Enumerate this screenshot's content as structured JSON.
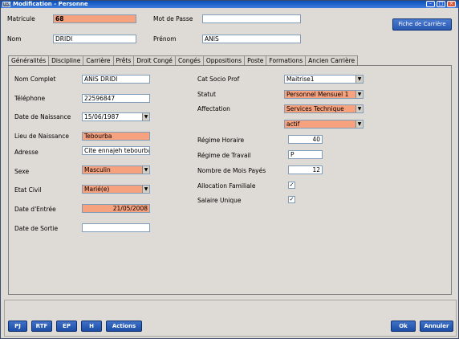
{
  "window": {
    "title": "Modification - Personne",
    "app_icon_text": "TDF"
  },
  "header": {
    "matricule_label": "Matricule",
    "matricule_value": "68",
    "mot_de_passe_label": "Mot de Passe",
    "mot_de_passe_value": "",
    "nom_label": "Nom",
    "nom_value": "DRIDI",
    "prenom_label": "Prénom",
    "prenom_value": "ANIS",
    "fiche_button": "Fiche de Carrière"
  },
  "tabs": [
    "Généralités",
    "Discipline",
    "Carrière",
    "Prêts",
    "Droit Congé",
    "Congés",
    "Oppositions",
    "Poste",
    "Formations",
    "Ancien Carrière"
  ],
  "left": {
    "nom_complet_label": "Nom Complet",
    "nom_complet_value": "ANIS DRIDI",
    "telephone_label": "Téléphone",
    "telephone_value": "22596847",
    "date_naissance_label": "Date de Naissance",
    "date_naissance_value": "15/06/1987",
    "lieu_naissance_label": "Lieu de Naissance",
    "lieu_naissance_value": "Tebourba",
    "adresse_label": "Adresse",
    "adresse_value": "Cite ennajeh tebourba",
    "sexe_label": "Sexe",
    "sexe_value": "Masculin",
    "etat_civil_label": "Etat Civil",
    "etat_civil_value": "Marié(e)",
    "date_entree_label": "Date d'Entrée",
    "date_entree_value": "21/05/2008",
    "date_sortie_label": "Date de Sortie",
    "date_sortie_value": ""
  },
  "right": {
    "cat_socio_label": "Cat Socio Prof",
    "cat_socio_value": "Maitrise1",
    "statut_label": "Statut",
    "statut_value": "Personnel Mensuel 1",
    "affectation_label": "Affectation",
    "affectation_value": "Services Technique",
    "etat_value": "actif",
    "regime_horaire_label": "Régime Horaire",
    "regime_horaire_value": "40",
    "regime_travail_label": "Régime de Travail",
    "regime_travail_value": "P",
    "nb_mois_label": "Nombre de Mois Payés",
    "nb_mois_value": "12",
    "allocation_label": "Allocation Familiale",
    "allocation_checked": "✓",
    "salaire_label": "Salaire Unique",
    "salaire_checked": "✓"
  },
  "footer": {
    "pj": "PJ",
    "rtf": "RTF",
    "ep": "EP",
    "h": "H",
    "actions": "Actions",
    "ok": "Ok",
    "annuler": "Annuler"
  },
  "colors": {
    "required_field": "#f7a27f",
    "button": "#2858b1",
    "titlebar": "#0a4fb8"
  }
}
